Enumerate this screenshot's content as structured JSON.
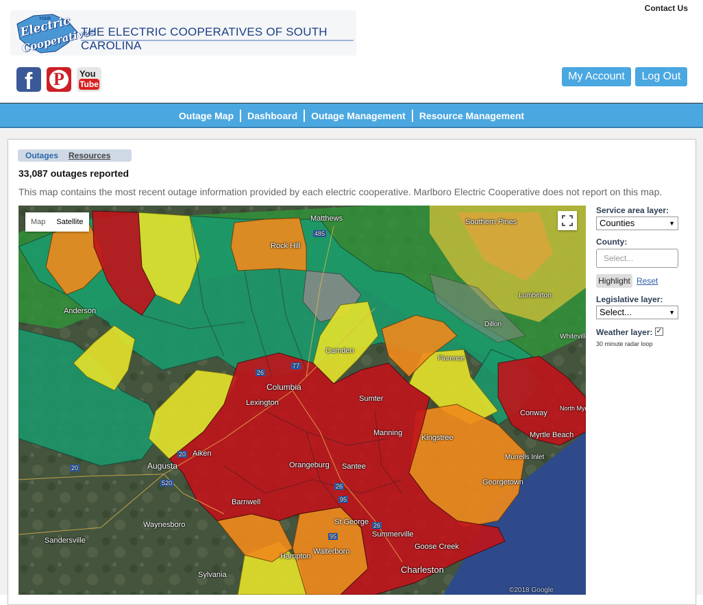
{
  "header": {
    "logo_your": "YOUR",
    "logo_electric": "Electric",
    "logo_coops": "Cooperatives",
    "logo_title": "THE ELECTRIC COOPERATIVES OF SOUTH CAROLINA",
    "contact_label": "Contact Us",
    "social": [
      {
        "name": "facebook-icon",
        "glyph": "f"
      },
      {
        "name": "pinterest-icon",
        "glyph": "P"
      },
      {
        "name": "youtube-icon",
        "glyph_top": "You",
        "glyph_bottom": "Tube"
      }
    ],
    "my_account_label": "My Account",
    "logout_label": "Log Out"
  },
  "nav": {
    "items": [
      "Outage Map",
      "Dashboard",
      "Outage Management",
      "Resource Management"
    ]
  },
  "content": {
    "tabs": [
      "Outages",
      "Resources"
    ],
    "outage_count": "33,087 outages reported",
    "description": "This map contains the most recent outage information provided by each electric cooperative. Marlboro Electric Cooperative does not report on this map."
  },
  "map": {
    "type_buttons": [
      "Map",
      "Satellite"
    ],
    "labels": [
      "Matthews",
      "Rock Hill",
      "Southern Pines",
      "Anderson",
      "Camden",
      "Columbia",
      "Lexington",
      "Sumter",
      "Conway",
      "Myrtle Beach",
      "North Myrtle Beach",
      "Manning",
      "Kingstree",
      "Augusta",
      "Aiken",
      "Orangeburg",
      "Santee",
      "Georgetown",
      "Barnwell",
      "Waynesboro",
      "Sandersville",
      "St George",
      "Summerville",
      "Goose Creek",
      "Walterboro",
      "Charleston",
      "Sylvania",
      "Hampton",
      "Murrells Inlet",
      "Florence",
      "Whiteville",
      "Lumberton",
      "Dillon"
    ],
    "highway_shields": [
      "485",
      "20",
      "520",
      "26",
      "77",
      "95",
      "26",
      "95",
      "26",
      "20"
    ],
    "attribution": "©2018 Google",
    "outage_colors": {
      "none": "#1a9a6c",
      "low": "#e5e22b",
      "medium": "#f08a1c",
      "high": "#c0141b",
      "no_report": "#8a8a8a"
    }
  },
  "controls": {
    "service_area_label": "Service area layer:",
    "service_area_value": "Counties",
    "county_label": "County:",
    "county_placeholder": "Select...",
    "highlight_label": "Highlight",
    "reset_label": "Reset",
    "legislative_label": "Legislative layer:",
    "legislative_value": "Select...",
    "weather_label": "Weather layer:",
    "weather_checked": "✓",
    "radar_note": "30 minute radar loop"
  }
}
